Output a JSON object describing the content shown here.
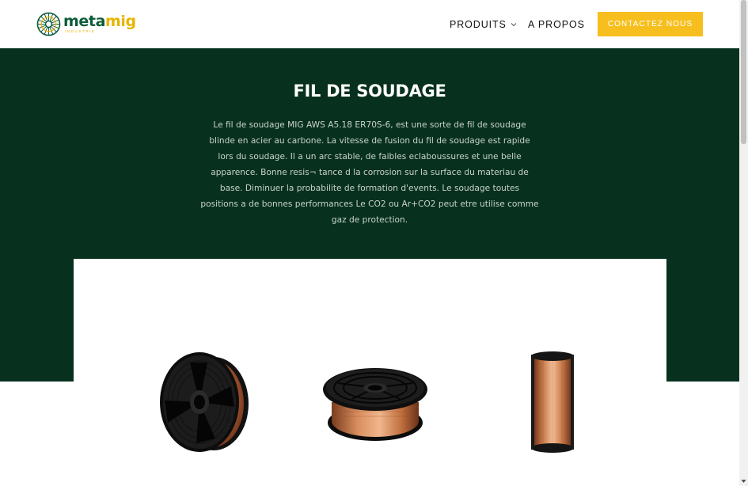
{
  "header": {
    "logo": {
      "word_part1": "meta",
      "word_part2": "mig",
      "tagline": "INDUSTRIE",
      "icon": "wire-spool-logo-icon"
    },
    "nav": {
      "produits_label": "PRODUITS",
      "apropos_label": "A PROPOS",
      "dropdown_icon": "chevron-down-icon"
    },
    "cta_label": "CONTACTEZ NOUS"
  },
  "hero": {
    "title": "FIL DE SOUDAGE",
    "description": "Le fil de soudage MIG AWS A5.18 ER70S-6, est une sorte de fil de soudage blinde en acier au carbone. La vitesse de fusion du fil de soudage est rapide lors du soudage. Il a un arc stable, de faibles eclaboussures et une belle apparence. Bonne resis¬ tance d la corrosion sur la surface du materiau de base. Diminuer la probabilite de formation d'events. Le soudage toutes positions a de bonnes performances Le CO2 ou Ar+CO2 peut etre utilise comme gaz de protection."
  },
  "products": [
    {
      "icon": "wire-spool-angled-icon"
    },
    {
      "icon": "wire-spool-flat-icon"
    },
    {
      "icon": "wire-spool-side-icon"
    }
  ],
  "colors": {
    "brand_green": "#0b5c3a",
    "brand_yellow": "#e8b400",
    "hero_background": "#07311e",
    "cta_background": "#f7bf1e",
    "copper": "#c8764a"
  }
}
